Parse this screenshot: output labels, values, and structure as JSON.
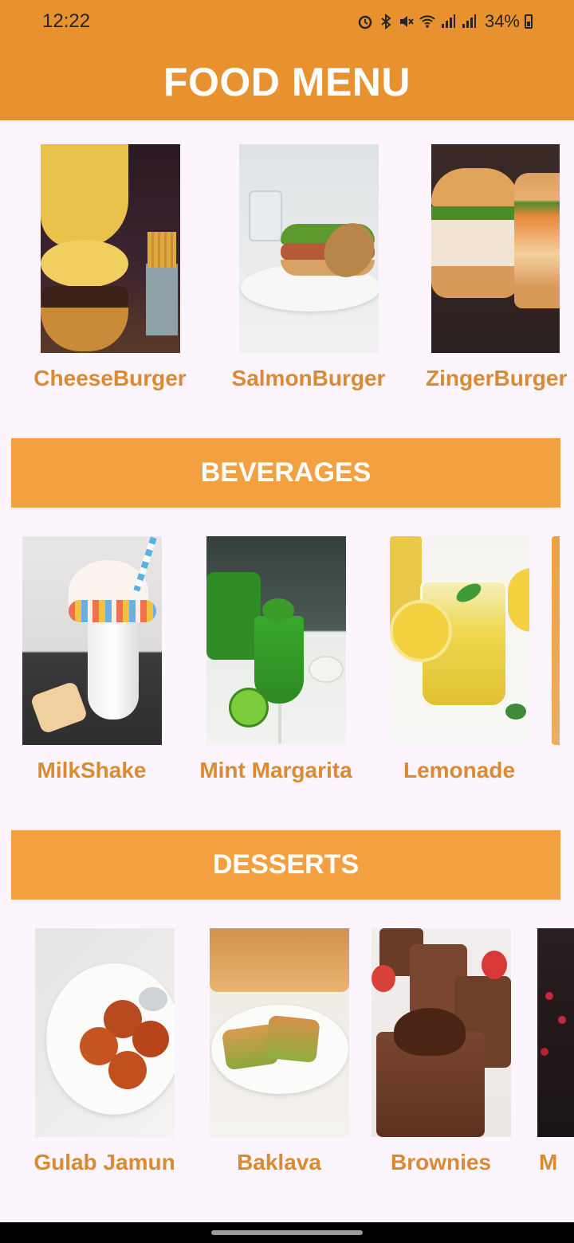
{
  "status": {
    "time": "12:22",
    "battery_pct": "34%",
    "icons": [
      "alarm-icon",
      "bluetooth-icon",
      "mute-icon",
      "wifi-icon",
      "signal-icon",
      "signal-icon",
      "battery-icon"
    ]
  },
  "header": {
    "title": "FOOD MENU"
  },
  "rows": {
    "food": [
      "CheeseBurger",
      "SalmonBurger",
      "ZingerBurger"
    ],
    "beverages_title": "BEVERAGES",
    "beverages": [
      "MilkShake",
      "Mint Margarita",
      "Lemonade"
    ],
    "desserts_title": "DESSERTS",
    "desserts": [
      "Gulab Jamun",
      "Baklava",
      "Brownies",
      "M"
    ]
  },
  "colors": {
    "accent": "#e8922f",
    "section": "#f3a040",
    "label": "#dc8a32",
    "background": "#fcf5fd"
  }
}
